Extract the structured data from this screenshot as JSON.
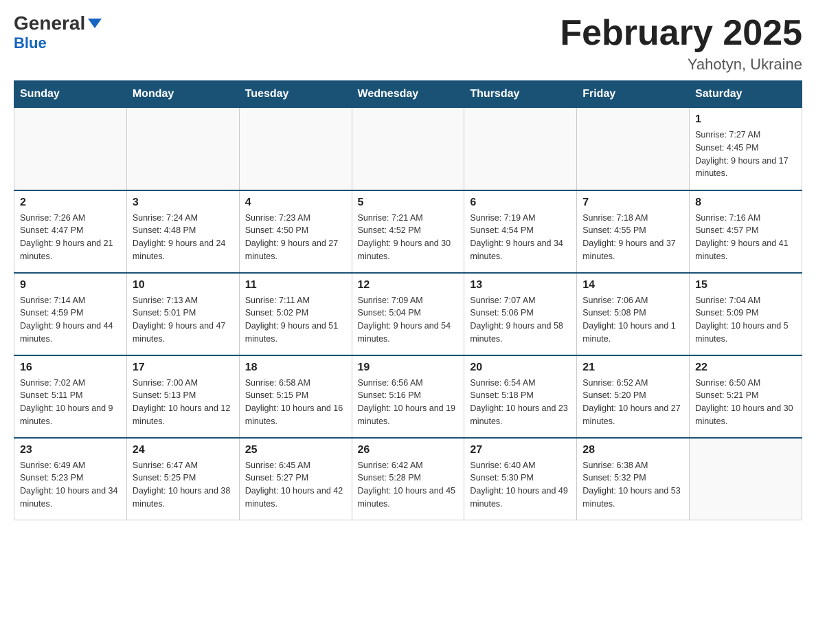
{
  "header": {
    "logo_general": "General",
    "logo_blue": "Blue",
    "month_title": "February 2025",
    "location": "Yahotyn, Ukraine"
  },
  "weekdays": [
    "Sunday",
    "Monday",
    "Tuesday",
    "Wednesday",
    "Thursday",
    "Friday",
    "Saturday"
  ],
  "weeks": [
    [
      {
        "day": "",
        "info": ""
      },
      {
        "day": "",
        "info": ""
      },
      {
        "day": "",
        "info": ""
      },
      {
        "day": "",
        "info": ""
      },
      {
        "day": "",
        "info": ""
      },
      {
        "day": "",
        "info": ""
      },
      {
        "day": "1",
        "info": "Sunrise: 7:27 AM\nSunset: 4:45 PM\nDaylight: 9 hours and 17 minutes."
      }
    ],
    [
      {
        "day": "2",
        "info": "Sunrise: 7:26 AM\nSunset: 4:47 PM\nDaylight: 9 hours and 21 minutes."
      },
      {
        "day": "3",
        "info": "Sunrise: 7:24 AM\nSunset: 4:48 PM\nDaylight: 9 hours and 24 minutes."
      },
      {
        "day": "4",
        "info": "Sunrise: 7:23 AM\nSunset: 4:50 PM\nDaylight: 9 hours and 27 minutes."
      },
      {
        "day": "5",
        "info": "Sunrise: 7:21 AM\nSunset: 4:52 PM\nDaylight: 9 hours and 30 minutes."
      },
      {
        "day": "6",
        "info": "Sunrise: 7:19 AM\nSunset: 4:54 PM\nDaylight: 9 hours and 34 minutes."
      },
      {
        "day": "7",
        "info": "Sunrise: 7:18 AM\nSunset: 4:55 PM\nDaylight: 9 hours and 37 minutes."
      },
      {
        "day": "8",
        "info": "Sunrise: 7:16 AM\nSunset: 4:57 PM\nDaylight: 9 hours and 41 minutes."
      }
    ],
    [
      {
        "day": "9",
        "info": "Sunrise: 7:14 AM\nSunset: 4:59 PM\nDaylight: 9 hours and 44 minutes."
      },
      {
        "day": "10",
        "info": "Sunrise: 7:13 AM\nSunset: 5:01 PM\nDaylight: 9 hours and 47 minutes."
      },
      {
        "day": "11",
        "info": "Sunrise: 7:11 AM\nSunset: 5:02 PM\nDaylight: 9 hours and 51 minutes."
      },
      {
        "day": "12",
        "info": "Sunrise: 7:09 AM\nSunset: 5:04 PM\nDaylight: 9 hours and 54 minutes."
      },
      {
        "day": "13",
        "info": "Sunrise: 7:07 AM\nSunset: 5:06 PM\nDaylight: 9 hours and 58 minutes."
      },
      {
        "day": "14",
        "info": "Sunrise: 7:06 AM\nSunset: 5:08 PM\nDaylight: 10 hours and 1 minute."
      },
      {
        "day": "15",
        "info": "Sunrise: 7:04 AM\nSunset: 5:09 PM\nDaylight: 10 hours and 5 minutes."
      }
    ],
    [
      {
        "day": "16",
        "info": "Sunrise: 7:02 AM\nSunset: 5:11 PM\nDaylight: 10 hours and 9 minutes."
      },
      {
        "day": "17",
        "info": "Sunrise: 7:00 AM\nSunset: 5:13 PM\nDaylight: 10 hours and 12 minutes."
      },
      {
        "day": "18",
        "info": "Sunrise: 6:58 AM\nSunset: 5:15 PM\nDaylight: 10 hours and 16 minutes."
      },
      {
        "day": "19",
        "info": "Sunrise: 6:56 AM\nSunset: 5:16 PM\nDaylight: 10 hours and 19 minutes."
      },
      {
        "day": "20",
        "info": "Sunrise: 6:54 AM\nSunset: 5:18 PM\nDaylight: 10 hours and 23 minutes."
      },
      {
        "day": "21",
        "info": "Sunrise: 6:52 AM\nSunset: 5:20 PM\nDaylight: 10 hours and 27 minutes."
      },
      {
        "day": "22",
        "info": "Sunrise: 6:50 AM\nSunset: 5:21 PM\nDaylight: 10 hours and 30 minutes."
      }
    ],
    [
      {
        "day": "23",
        "info": "Sunrise: 6:49 AM\nSunset: 5:23 PM\nDaylight: 10 hours and 34 minutes."
      },
      {
        "day": "24",
        "info": "Sunrise: 6:47 AM\nSunset: 5:25 PM\nDaylight: 10 hours and 38 minutes."
      },
      {
        "day": "25",
        "info": "Sunrise: 6:45 AM\nSunset: 5:27 PM\nDaylight: 10 hours and 42 minutes."
      },
      {
        "day": "26",
        "info": "Sunrise: 6:42 AM\nSunset: 5:28 PM\nDaylight: 10 hours and 45 minutes."
      },
      {
        "day": "27",
        "info": "Sunrise: 6:40 AM\nSunset: 5:30 PM\nDaylight: 10 hours and 49 minutes."
      },
      {
        "day": "28",
        "info": "Sunrise: 6:38 AM\nSunset: 5:32 PM\nDaylight: 10 hours and 53 minutes."
      },
      {
        "day": "",
        "info": ""
      }
    ]
  ]
}
